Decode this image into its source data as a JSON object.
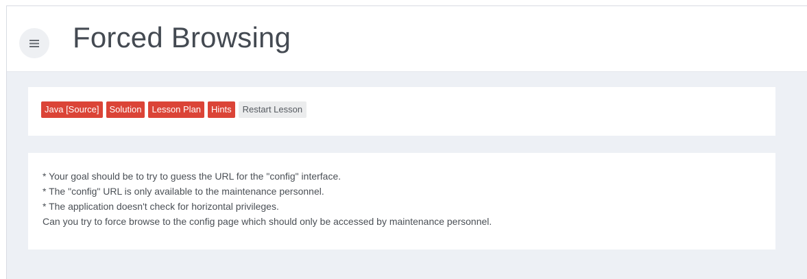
{
  "header": {
    "title": "Forced Browsing",
    "menu_icon": "hamburger-icon"
  },
  "toolbar": {
    "buttons": [
      {
        "label": "Java [Source]",
        "style": "primary"
      },
      {
        "label": "Solution",
        "style": "primary"
      },
      {
        "label": "Lesson Plan",
        "style": "primary"
      },
      {
        "label": "Hints",
        "style": "primary"
      },
      {
        "label": "Restart Lesson",
        "style": "default"
      }
    ]
  },
  "lesson": {
    "lines": [
      "* Your goal should be to try to guess the URL for the \"config\" interface.",
      "* The \"config\" URL is only available to the maintenance personnel.",
      "* The application doesn't check for horizontal privileges.",
      "Can you try to force browse to the config page which should only be accessed by maintenance personnel."
    ]
  },
  "colors": {
    "primary_button": "#db4437",
    "default_button": "#ebeced",
    "content_background": "#edf0f5",
    "title_text": "#444a52"
  }
}
